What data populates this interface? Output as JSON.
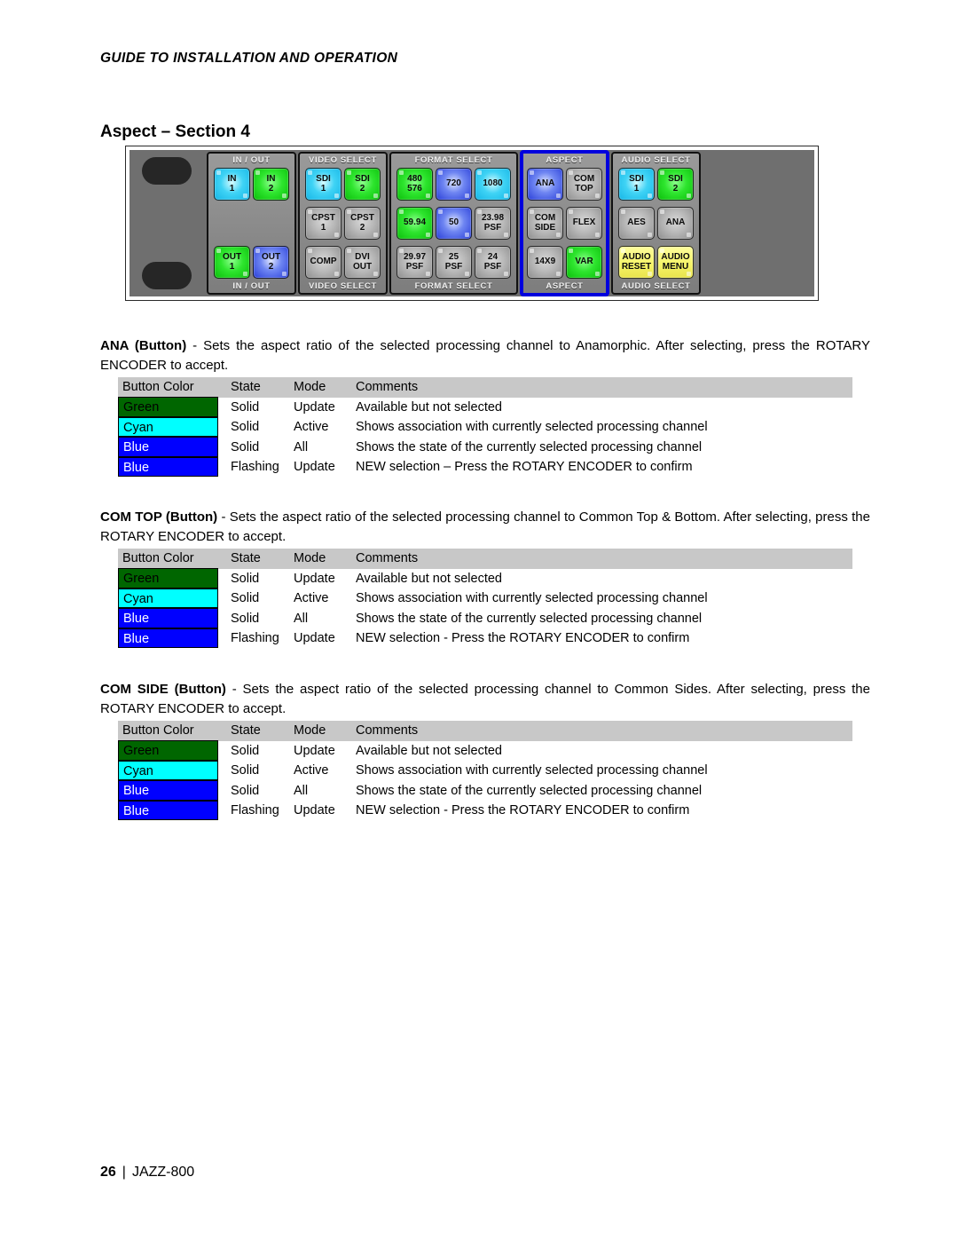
{
  "header": {
    "running_head": "GUIDE TO INSTALLATION AND OPERATION",
    "section_title": "Aspect – Section 4"
  },
  "control_panel": {
    "alt": "JAZZ-800 front control panel with ASPECT group highlighted",
    "groups": [
      {
        "name": "in-out",
        "label_top": "IN / OUT",
        "label_bottom": "IN / OUT",
        "columns": 2,
        "highlighted": false,
        "buttons": [
          {
            "label": "IN\n1",
            "text": "IN 1",
            "color": "cyan"
          },
          {
            "label": "IN 2",
            "text": "IN 2",
            "color": "green"
          },
          {
            "label": "spacer",
            "text": "",
            "color": "spacer"
          },
          {
            "label": "spacer",
            "text": "",
            "color": "spacer"
          },
          {
            "label": "OUT 1",
            "text": "OUT 1",
            "color": "green"
          },
          {
            "label": "OUT 2",
            "text": "OUT 2",
            "color": "blue"
          }
        ]
      },
      {
        "name": "video-select",
        "label_top": "VIDEO SELECT",
        "label_bottom": "VIDEO SELECT",
        "columns": 2,
        "highlighted": false,
        "buttons": [
          {
            "text": "SDI 1",
            "color": "cyan"
          },
          {
            "text": "SDI 2",
            "color": "green"
          },
          {
            "text": "CPST 1",
            "color": "grey"
          },
          {
            "text": "CPST 2",
            "color": "grey"
          },
          {
            "text": "COMP",
            "color": "grey"
          },
          {
            "text": "DVI OUT",
            "color": "grey"
          }
        ]
      },
      {
        "name": "format-select",
        "label_top": "FORMAT SELECT",
        "label_bottom": "FORMAT SELECT",
        "columns": 3,
        "highlighted": false,
        "buttons": [
          {
            "text": "480 576",
            "color": "green"
          },
          {
            "text": "720",
            "color": "blue"
          },
          {
            "text": "1080",
            "color": "cyan"
          },
          {
            "text": "59.94",
            "color": "green"
          },
          {
            "text": "50",
            "color": "blue"
          },
          {
            "text": "23.98 PSF",
            "color": "grey"
          },
          {
            "text": "29.97 PSF",
            "color": "grey"
          },
          {
            "text": "25 PSF",
            "color": "grey"
          },
          {
            "text": "24 PSF",
            "color": "grey"
          }
        ]
      },
      {
        "name": "aspect",
        "label_top": "ASPECT",
        "label_bottom": "ASPECT",
        "columns": 2,
        "highlighted": true,
        "highlight_color": "#0000dd",
        "buttons": [
          {
            "text": "ANA",
            "color": "blue"
          },
          {
            "text": "COM TOP",
            "color": "grey"
          },
          {
            "text": "COM SIDE",
            "color": "grey"
          },
          {
            "text": "FLEX",
            "color": "grey"
          },
          {
            "text": "14X9",
            "color": "grey"
          },
          {
            "text": "VAR",
            "color": "green"
          }
        ]
      },
      {
        "name": "audio-select",
        "label_top": "AUDIO SELECT",
        "label_bottom": "AUDIO SELECT",
        "columns": 2,
        "highlighted": false,
        "buttons": [
          {
            "text": "SDI 1",
            "color": "cyan"
          },
          {
            "text": "SDI 2",
            "color": "green"
          },
          {
            "text": "AES",
            "color": "grey"
          },
          {
            "text": "ANA",
            "color": "grey"
          },
          {
            "text": "AUDIO RESET",
            "color": "yellow"
          },
          {
            "text": "AUDIO MENU",
            "color": "yellow"
          }
        ]
      }
    ]
  },
  "sections": [
    {
      "id": "ana",
      "heading": "ANA (Button)",
      "body": " - Sets the aspect ratio of the selected processing channel to Anamorphic. After selecting, press the ROTARY ENCODER to accept.",
      "table": {
        "headers": [
          "Button Color",
          "State",
          "Mode",
          "Comments"
        ],
        "rows": [
          {
            "color": "Green",
            "swatch": "#006600",
            "text_color": "#000000",
            "state": "Solid",
            "mode": "Update",
            "comments": "Available but not selected"
          },
          {
            "color": "Cyan",
            "swatch": "#00ffff",
            "text_color": "#000000",
            "state": "Solid",
            "mode": "Active",
            "comments": "Shows association with currently selected processing channel"
          },
          {
            "color": "Blue",
            "swatch": "#0000ff",
            "text_color": "#ffffff",
            "state": "Solid",
            "mode": "All",
            "comments": "Shows the state of the currently selected processing channel"
          },
          {
            "color": "Blue",
            "swatch": "#0000ff",
            "text_color": "#ffffff",
            "state": "Flashing",
            "mode": "Update",
            "comments": "NEW selection – Press the ROTARY ENCODER to confirm"
          }
        ]
      }
    },
    {
      "id": "com-top",
      "heading": "COM TOP (Button)",
      "body": " - Sets the aspect ratio of the selected processing channel to Common Top & Bottom. After selecting, press the ROTARY ENCODER to accept.",
      "table": {
        "headers": [
          "Button Color",
          "State",
          "Mode",
          "Comments"
        ],
        "rows": [
          {
            "color": "Green",
            "swatch": "#006600",
            "text_color": "#000000",
            "state": "Solid",
            "mode": "Update",
            "comments": "Available but not selected"
          },
          {
            "color": "Cyan",
            "swatch": "#00ffff",
            "text_color": "#000000",
            "state": "Solid",
            "mode": "Active",
            "comments": "Shows association with currently selected processing channel"
          },
          {
            "color": "Blue",
            "swatch": "#0000ff",
            "text_color": "#ffffff",
            "state": "Solid",
            "mode": "All",
            "comments": "Shows the state of the currently selected processing channel"
          },
          {
            "color": "Blue",
            "swatch": "#0000ff",
            "text_color": "#ffffff",
            "state": "Flashing",
            "mode": "Update",
            "comments": "NEW selection - Press the ROTARY ENCODER to confirm"
          }
        ]
      }
    },
    {
      "id": "com-side",
      "heading": "COM SIDE (Button)",
      "body": " - Sets the aspect ratio of the selected processing channel to Common Sides. After selecting, press the ROTARY ENCODER to accept.",
      "table": {
        "headers": [
          "Button Color",
          "State",
          "Mode",
          "Comments"
        ],
        "rows": [
          {
            "color": "Green",
            "swatch": "#006600",
            "text_color": "#000000",
            "state": "Solid",
            "mode": "Update",
            "comments": "Available but not selected"
          },
          {
            "color": "Cyan",
            "swatch": "#00ffff",
            "text_color": "#000000",
            "state": "Solid",
            "mode": "Active",
            "comments": "Shows association with currently selected processing channel"
          },
          {
            "color": "Blue",
            "swatch": "#0000ff",
            "text_color": "#ffffff",
            "state": "Solid",
            "mode": "All",
            "comments": "Shows the state of the currently selected processing channel"
          },
          {
            "color": "Blue",
            "swatch": "#0000ff",
            "text_color": "#ffffff",
            "state": "Flashing",
            "mode": "Update",
            "comments": "NEW selection - Press the ROTARY ENCODER to confirm"
          }
        ]
      }
    }
  ],
  "footer": {
    "page_number": "26",
    "separator": "|",
    "product": "JAZZ-800"
  }
}
